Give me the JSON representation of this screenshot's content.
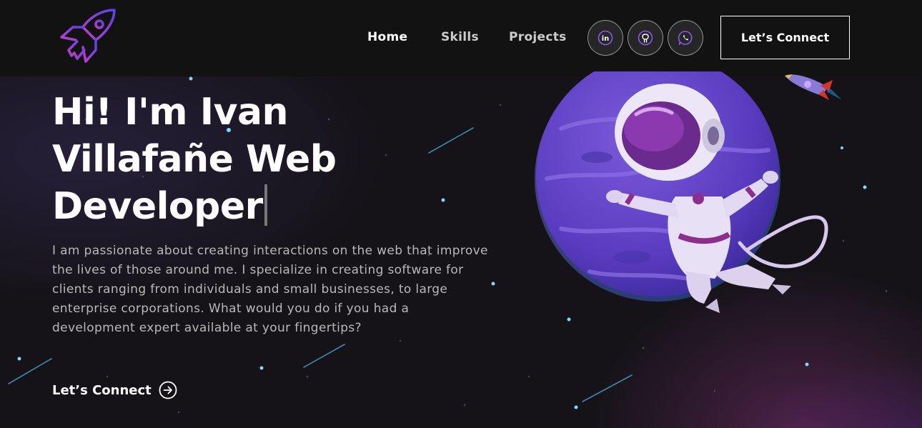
{
  "nav": {
    "links": [
      {
        "label": "Home",
        "active": true
      },
      {
        "label": "Skills",
        "active": false
      },
      {
        "label": "Projects",
        "active": false
      }
    ],
    "social": [
      {
        "icon": "linkedin-icon",
        "glyph": "in"
      },
      {
        "icon": "github-icon",
        "glyph": ""
      },
      {
        "icon": "whatsapp-icon",
        "glyph": ""
      }
    ],
    "connect_label": "Let’s Connect"
  },
  "hero": {
    "headline_lines": [
      "Hi! I'm Ivan",
      "Villafañe Web",
      "Developer"
    ],
    "description": "I am passionate about creating interactions on the web that improve the lives of those around me. I specialize in creating software for clients ranging from individuals and small businesses, to large enterprise corporations. What would you do if you had a development expert available at your fingertips?",
    "cta_label": "Let’s Connect"
  },
  "colors": {
    "accent": "#7b3fe4",
    "accent_pink": "#c23ec8",
    "background": "#121212",
    "planet": "#6a48c8"
  }
}
